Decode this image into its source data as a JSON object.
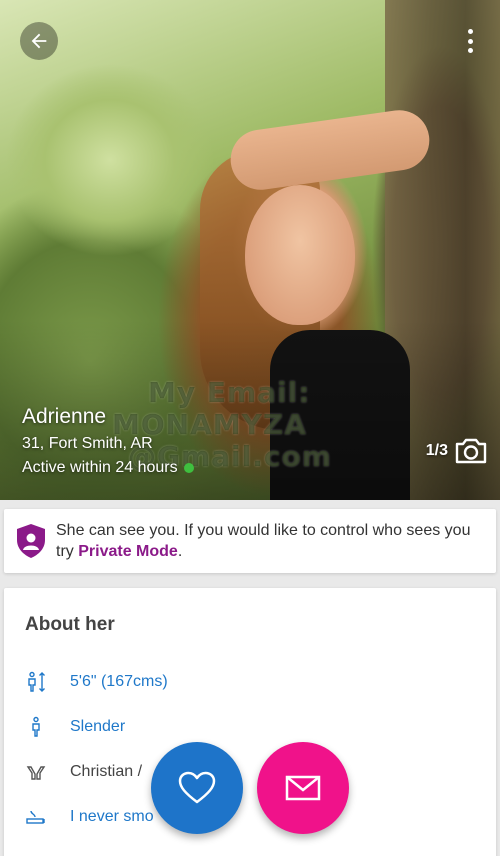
{
  "profile": {
    "name": "Adrienne",
    "age_location": "31, Fort Smith, AR",
    "activity": "Active within 24 hours",
    "photo_counter": "1/3",
    "watermark": [
      "My Email:",
      "MONAMYZA",
      "@Gmail.com"
    ]
  },
  "privacy_notice": {
    "text": "She can see you. If you would like to control who sees you try",
    "link": "Private Mode",
    "suffix": "."
  },
  "about": {
    "title": "About her",
    "attributes": [
      {
        "icon": "height-icon",
        "value": "5'6\" (167cms)"
      },
      {
        "icon": "body-type-icon",
        "value": "Slender"
      },
      {
        "icon": "religion-icon",
        "value": "Christian /"
      },
      {
        "icon": "smoking-icon",
        "value": "I never smo"
      }
    ]
  },
  "colors": {
    "accent_blue": "#1e74c9",
    "accent_pink": "#f0128a",
    "brand_purple": "#8b1a89",
    "online_green": "#3fbf3f"
  }
}
